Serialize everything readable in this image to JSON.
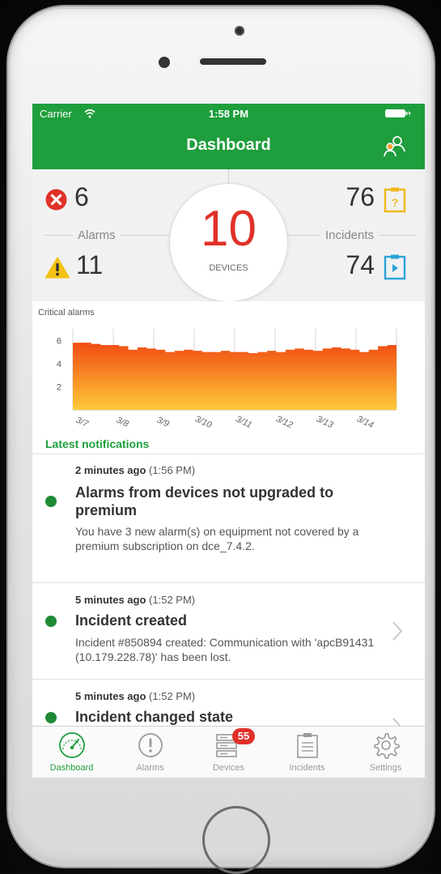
{
  "status_bar": {
    "carrier": "Carrier",
    "time": "1:58 PM"
  },
  "nav": {
    "title": "Dashboard",
    "right_icon": "users-icon"
  },
  "summary": {
    "alarms_label": "Alarms",
    "critical_alarms": "6",
    "warning_alarms": "11",
    "incidents_label": "Incidents",
    "incidents_open": "76",
    "incidents_in_progress": "74",
    "devices_count": "10",
    "devices_label": "DEVICES"
  },
  "chart_data": {
    "type": "area",
    "title": "Critical alarms",
    "x_ticks": [
      "3/7",
      "3/8",
      "3/9",
      "3/10",
      "3/11",
      "3/12",
      "3/13",
      "3/14"
    ],
    "y_ticks": [
      "6",
      "4",
      "2"
    ],
    "ylim": [
      0,
      7
    ],
    "series": [
      {
        "values": [
          5.8,
          5.8,
          5.7,
          5.6,
          5.6,
          5.5,
          5.2,
          5.4,
          5.3,
          5.2,
          5.0,
          5.1,
          5.2,
          5.1,
          5.0,
          5.0,
          5.1,
          5.0,
          5.0,
          4.9,
          5.0,
          5.1,
          5.0,
          5.2,
          5.3,
          5.2,
          5.1,
          5.3,
          5.4,
          5.3,
          5.2,
          5.0,
          5.2,
          5.5,
          5.6,
          5.9
        ],
        "fill_top": "#f04a12",
        "fill_bottom": "#ffc93a"
      }
    ],
    "grid": true
  },
  "latest_notifications_title": "Latest notifications",
  "notifications": [
    {
      "time_ago": "2 minutes ago",
      "time": "(1:56 PM)",
      "title": "Alarms from devices not upgraded to premium",
      "body": "You have 3 new alarm(s) on equipment not covered by a premium subscription on dce_7.4.2.",
      "has_chevron": false
    },
    {
      "time_ago": "5 minutes ago",
      "time": "(1:52 PM)",
      "title": "Incident created",
      "body": "Incident #850894 created: Communication with 'apcB91431 (10.179.228.78)' has been lost.",
      "has_chevron": true
    },
    {
      "time_ago": "5 minutes ago",
      "time": "(1:52 PM)",
      "title": "Incident changed state",
      "body": "",
      "has_chevron": true
    }
  ],
  "tabs": [
    {
      "label": "Dashboard",
      "icon": "gauge-icon",
      "active": true
    },
    {
      "label": "Alarms",
      "icon": "alert-circle-icon",
      "active": false
    },
    {
      "label": "Devices",
      "icon": "server-icon",
      "active": false,
      "badge": "55"
    },
    {
      "label": "Incidents",
      "icon": "clipboard-icon",
      "active": false
    },
    {
      "label": "Settings",
      "icon": "gear-icon",
      "active": false
    }
  ],
  "colors": {
    "brand_green": "#1e9e3c",
    "alert_red": "#e03129",
    "warning_yellow": "#f3c313",
    "incident_yellow": "#f0b81d",
    "incident_blue": "#2aa3d8"
  }
}
